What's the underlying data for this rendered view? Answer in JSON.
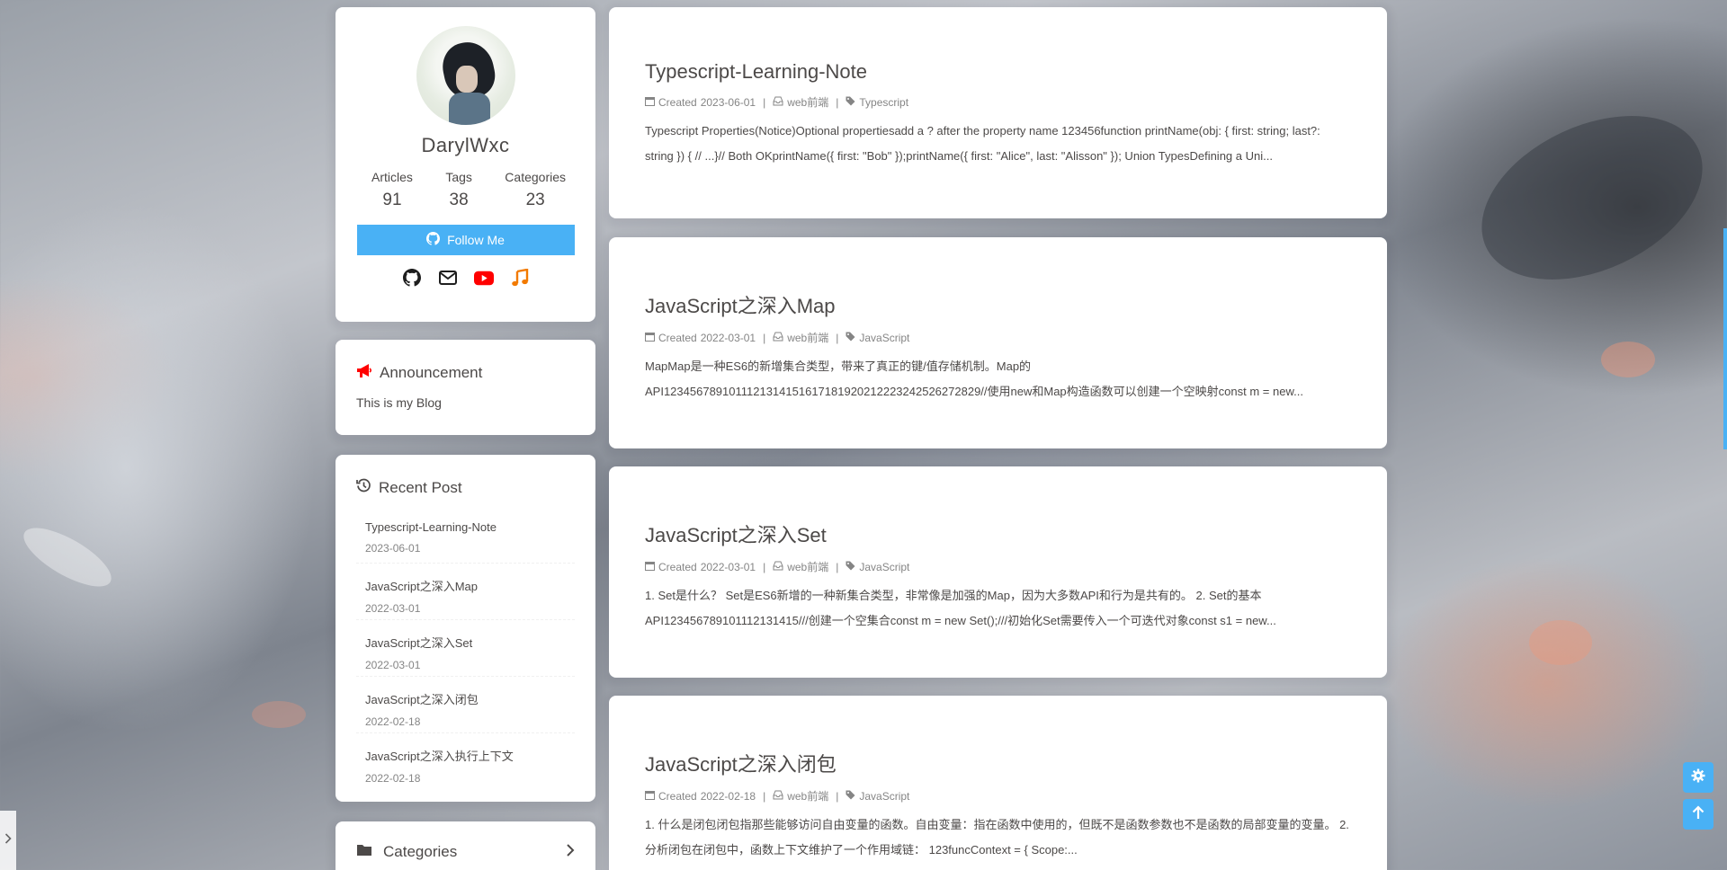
{
  "author": {
    "name": "DarylWxc",
    "stats": [
      {
        "label": "Articles",
        "value": "91"
      },
      {
        "label": "Tags",
        "value": "38"
      },
      {
        "label": "Categories",
        "value": "23"
      }
    ],
    "follow_label": "Follow Me",
    "social_icons": [
      "github-icon",
      "envelope-icon",
      "youtube-icon",
      "music-icon"
    ]
  },
  "announcement": {
    "title": "Announcement",
    "text": "This is my Blog"
  },
  "recent": {
    "title": "Recent Post",
    "items": [
      {
        "title": "Typescript-Learning-Note",
        "date": "2023-06-01"
      },
      {
        "title": "JavaScript之深入Map",
        "date": "2022-03-01"
      },
      {
        "title": "JavaScript之深入Set",
        "date": "2022-03-01"
      },
      {
        "title": "JavaScript之深入闭包",
        "date": "2022-02-18"
      },
      {
        "title": "JavaScript之深入执行上下文",
        "date": "2022-02-18"
      }
    ]
  },
  "categories": {
    "title": "Categories"
  },
  "posts": [
    {
      "title": "Typescript-Learning-Note",
      "created_label": "Created",
      "date": "2023-06-01",
      "category": "web前端",
      "tag": "Typescript",
      "excerpt": "Typescript Properties(Notice)Optional propertiesadd a ? after the property name 123456function printName(obj: { first: string; last?: string }) { // ...}// Both OKprintName({ first: \"Bob\" });printName({ first: \"Alice\", last: \"Alisson\" }); Union TypesDefining a Uni..."
    },
    {
      "title": "JavaScript之深入Map",
      "created_label": "Created",
      "date": "2022-03-01",
      "category": "web前端",
      "tag": "JavaScript",
      "excerpt": "MapMap是一种ES6的新增集合类型，带来了真正的键/值存储机制。Map的API1234567891011121314151617181920212223242526272829//使用new和Map构造函数可以创建一个空映射const m = new..."
    },
    {
      "title": "JavaScript之深入Set",
      "created_label": "Created",
      "date": "2022-03-01",
      "category": "web前端",
      "tag": "JavaScript",
      "excerpt": "1. Set是什么？ Set是ES6新增的一种新集合类型，非常像是加强的Map，因为大多数API和行为是共有的。 2. Set的基本API123456789101112131415///创建一个空集合const m = new Set();///初始化Set需要传入一个可迭代对象const s1 = new..."
    },
    {
      "title": "JavaScript之深入闭包",
      "created_label": "Created",
      "date": "2022-02-18",
      "category": "web前端",
      "tag": "JavaScript",
      "excerpt": "1. 什么是闭包闭包指那些能够访问自由变量的函数。自由变量：指在函数中使用的，但既不是函数参数也不是函数的局部变量的变量。 2. 分析闭包在闭包中，函数上下文维护了一个作用域链： 123funcContext = { Scope:..."
    }
  ],
  "colors": {
    "accent": "#49b1f5",
    "text": "#4c4948",
    "meta": "#858585",
    "announcement_icon": "#ff0000",
    "youtube": "#ff0000",
    "music": "#f27a00"
  }
}
